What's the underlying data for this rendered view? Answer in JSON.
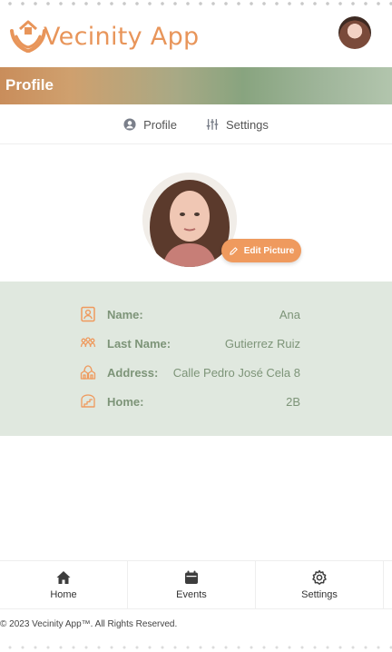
{
  "app": {
    "name": "Vecinity App"
  },
  "banner": {
    "title": "Profile"
  },
  "tabs": [
    {
      "label": "Profile",
      "icon": "user-circle-icon"
    },
    {
      "label": "Settings",
      "icon": "sliders-icon"
    }
  ],
  "profile": {
    "edit_label": "Edit Picture"
  },
  "info": {
    "name_label": "Name:",
    "name_value": "Ana",
    "lastname_label": "Last Name:",
    "lastname_value": "Gutierrez Ruiz",
    "address_label": "Address:",
    "address_value": "Calle Pedro José Cela 8",
    "home_label": "Home:",
    "home_value": "2B"
  },
  "nav": [
    {
      "label": "Home",
      "icon": "home-icon"
    },
    {
      "label": "Events",
      "icon": "calendar-icon"
    },
    {
      "label": "Settings",
      "icon": "gear-icon"
    }
  ],
  "footer": {
    "copyright": "© 2023 Vecinity App™. All Rights Reserved."
  },
  "colors": {
    "accent": "#ef9a5e",
    "green": "#7d9478",
    "panel": "#e0e8df"
  }
}
